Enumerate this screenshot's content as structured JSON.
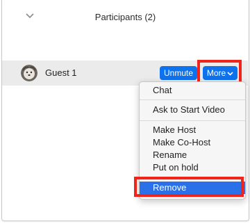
{
  "header": {
    "title": "Participants (2)"
  },
  "participants": [
    {
      "name": "Guest 1",
      "unmute_label": "Unmute",
      "more_label": "More"
    }
  ],
  "menu": {
    "items": [
      "Chat",
      "Ask to Start Video",
      "Make Host",
      "Make Co-Host",
      "Rename",
      "Put on hold",
      "Remove"
    ],
    "selected": "Remove"
  },
  "colors": {
    "accent": "#0e72ed",
    "highlight": "#f0241b",
    "selection": "#2a70e8"
  },
  "icons": [
    "chevron-down-icon",
    "avatar",
    "chevron-down-icon"
  ]
}
